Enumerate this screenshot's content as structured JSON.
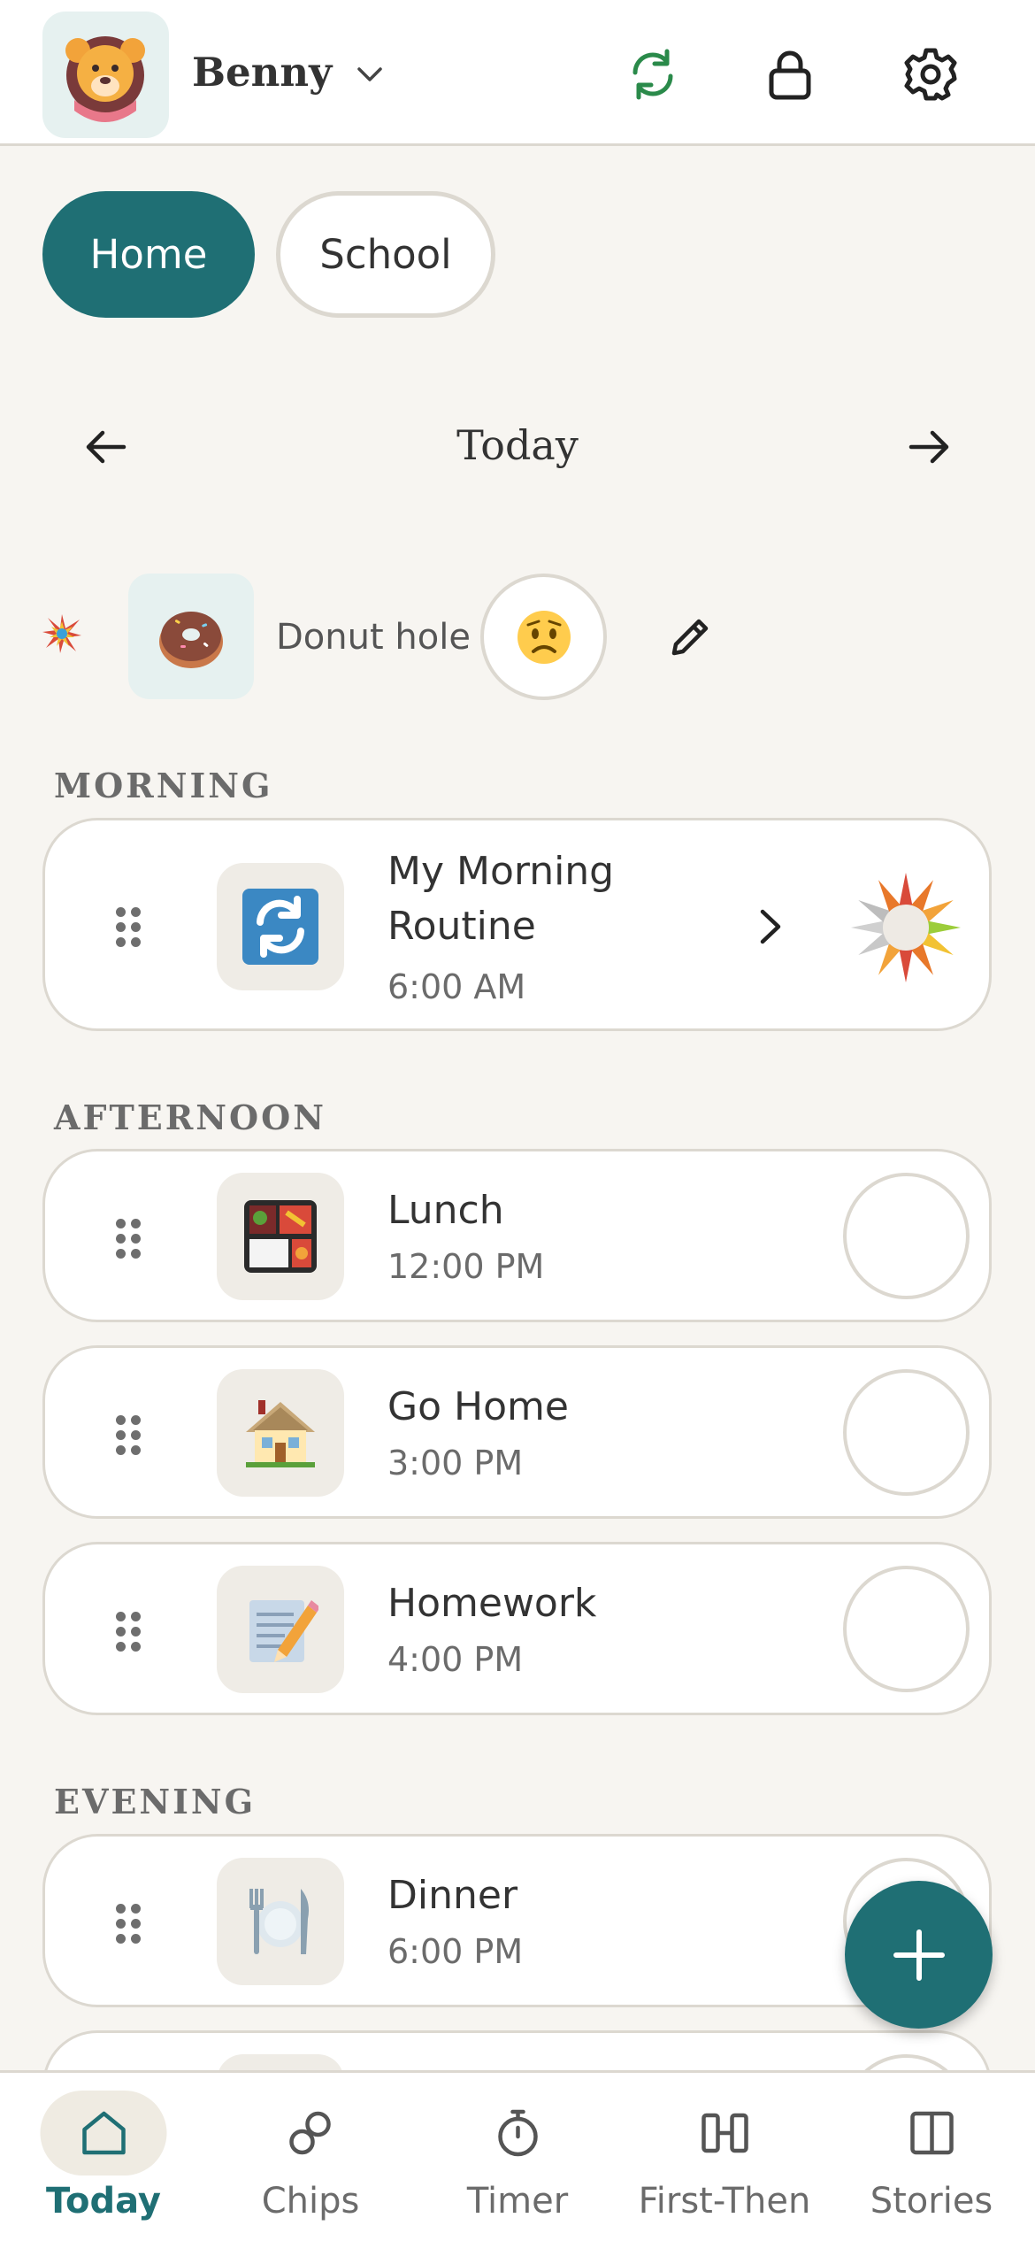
{
  "header": {
    "profile_name": "Benny",
    "icons": [
      "lion-avatar-icon",
      "chevron-down-icon",
      "sync-icon",
      "lock-icon",
      "gear-icon"
    ],
    "sync_color": "#2a8a4a"
  },
  "contexts": [
    {
      "label": "Home",
      "selected": true
    },
    {
      "label": "School",
      "selected": false
    }
  ],
  "date_nav": {
    "label": "Today"
  },
  "mood": {
    "label": "Donut hole",
    "icons": [
      "burst-icon",
      "donut-icon",
      "worried-face-icon",
      "pencil-icon"
    ]
  },
  "sections": {
    "morning": "MORNING",
    "afternoon": "AFTERNOON",
    "evening": "EVENING"
  },
  "routines": {
    "morning": [
      {
        "title": "My Morning Routine",
        "time": "6:00 AM",
        "icon": "repeat-icon",
        "progress_icon": "sun-progress-icon"
      }
    ],
    "afternoon": [
      {
        "title": "Lunch",
        "time": "12:00 PM",
        "icon": "bento-box-icon"
      },
      {
        "title": "Go Home",
        "time": "3:00 PM",
        "icon": "house-icon"
      },
      {
        "title": "Homework",
        "time": "4:00 PM",
        "icon": "memo-pencil-icon"
      }
    ],
    "evening": [
      {
        "title": "Dinner",
        "time": "6:00 PM",
        "icon": "plate-fork-knife-icon"
      }
    ]
  },
  "bottom_nav": [
    {
      "label": "Today",
      "icon": "home-icon",
      "active": true
    },
    {
      "label": "Chips",
      "icon": "chips-icon",
      "active": false
    },
    {
      "label": "Timer",
      "icon": "stopwatch-icon",
      "active": false
    },
    {
      "label": "First-Then",
      "icon": "first-then-icon",
      "active": false
    },
    {
      "label": "Stories",
      "icon": "book-icon",
      "active": false
    }
  ],
  "colors": {
    "accent": "#1f6f74",
    "background": "#f7f5f1",
    "border": "#dcd8d0"
  }
}
